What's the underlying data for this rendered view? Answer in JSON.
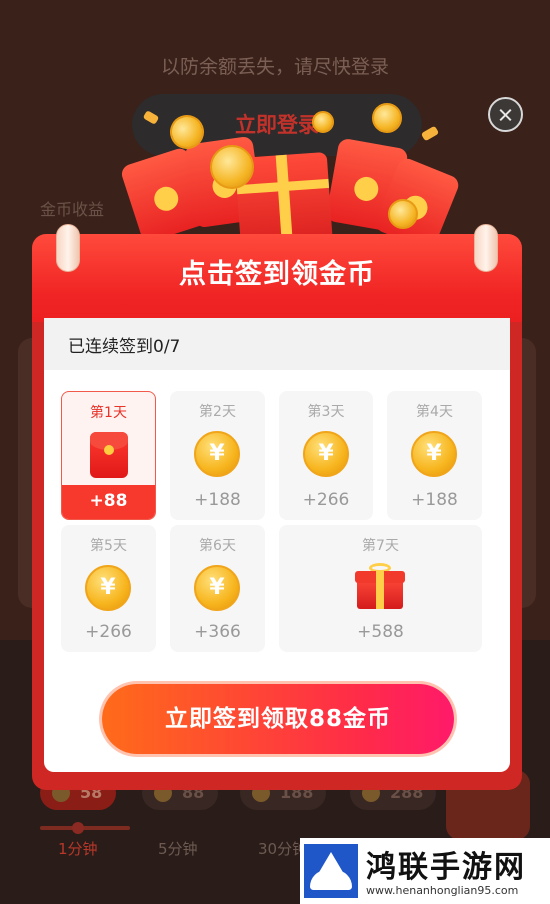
{
  "background": {
    "hint": "以防余额丢失，请尽快登录",
    "login_button": "立即登录",
    "coin_label": "金币收益",
    "chips": [
      {
        "value": "58",
        "time": "1分钟"
      },
      {
        "value": "88",
        "time": "5分钟"
      },
      {
        "value": "188",
        "time": "30分钟"
      },
      {
        "value": "288",
        "time": ""
      }
    ]
  },
  "modal": {
    "title": "点击签到领金币",
    "streak": "已连续签到0/7",
    "coin_symbol": "¥",
    "days": [
      {
        "label": "第1天",
        "amount": "+88",
        "icon": "red-envelope-icon",
        "active": true
      },
      {
        "label": "第2天",
        "amount": "+188",
        "icon": "gold-coin-icon"
      },
      {
        "label": "第3天",
        "amount": "+266",
        "icon": "gold-coin-icon"
      },
      {
        "label": "第4天",
        "amount": "+188",
        "icon": "gold-coin-icon"
      },
      {
        "label": "第5天",
        "amount": "+266",
        "icon": "gold-coin-icon"
      },
      {
        "label": "第6天",
        "amount": "+366",
        "icon": "gold-coin-icon"
      },
      {
        "label": "第7天",
        "amount": "+588",
        "icon": "gift-box-icon"
      }
    ],
    "sign_button": "立即签到领取88金币"
  },
  "watermark": {
    "title": "鸿联手游网",
    "url": "www.henanhonglian95.com"
  },
  "colors": {
    "accent_red": "#f02424",
    "button_gradient_start": "#ff6b1a",
    "button_gradient_end": "#ff1a6a",
    "coin_gold": "#f7b51e"
  }
}
